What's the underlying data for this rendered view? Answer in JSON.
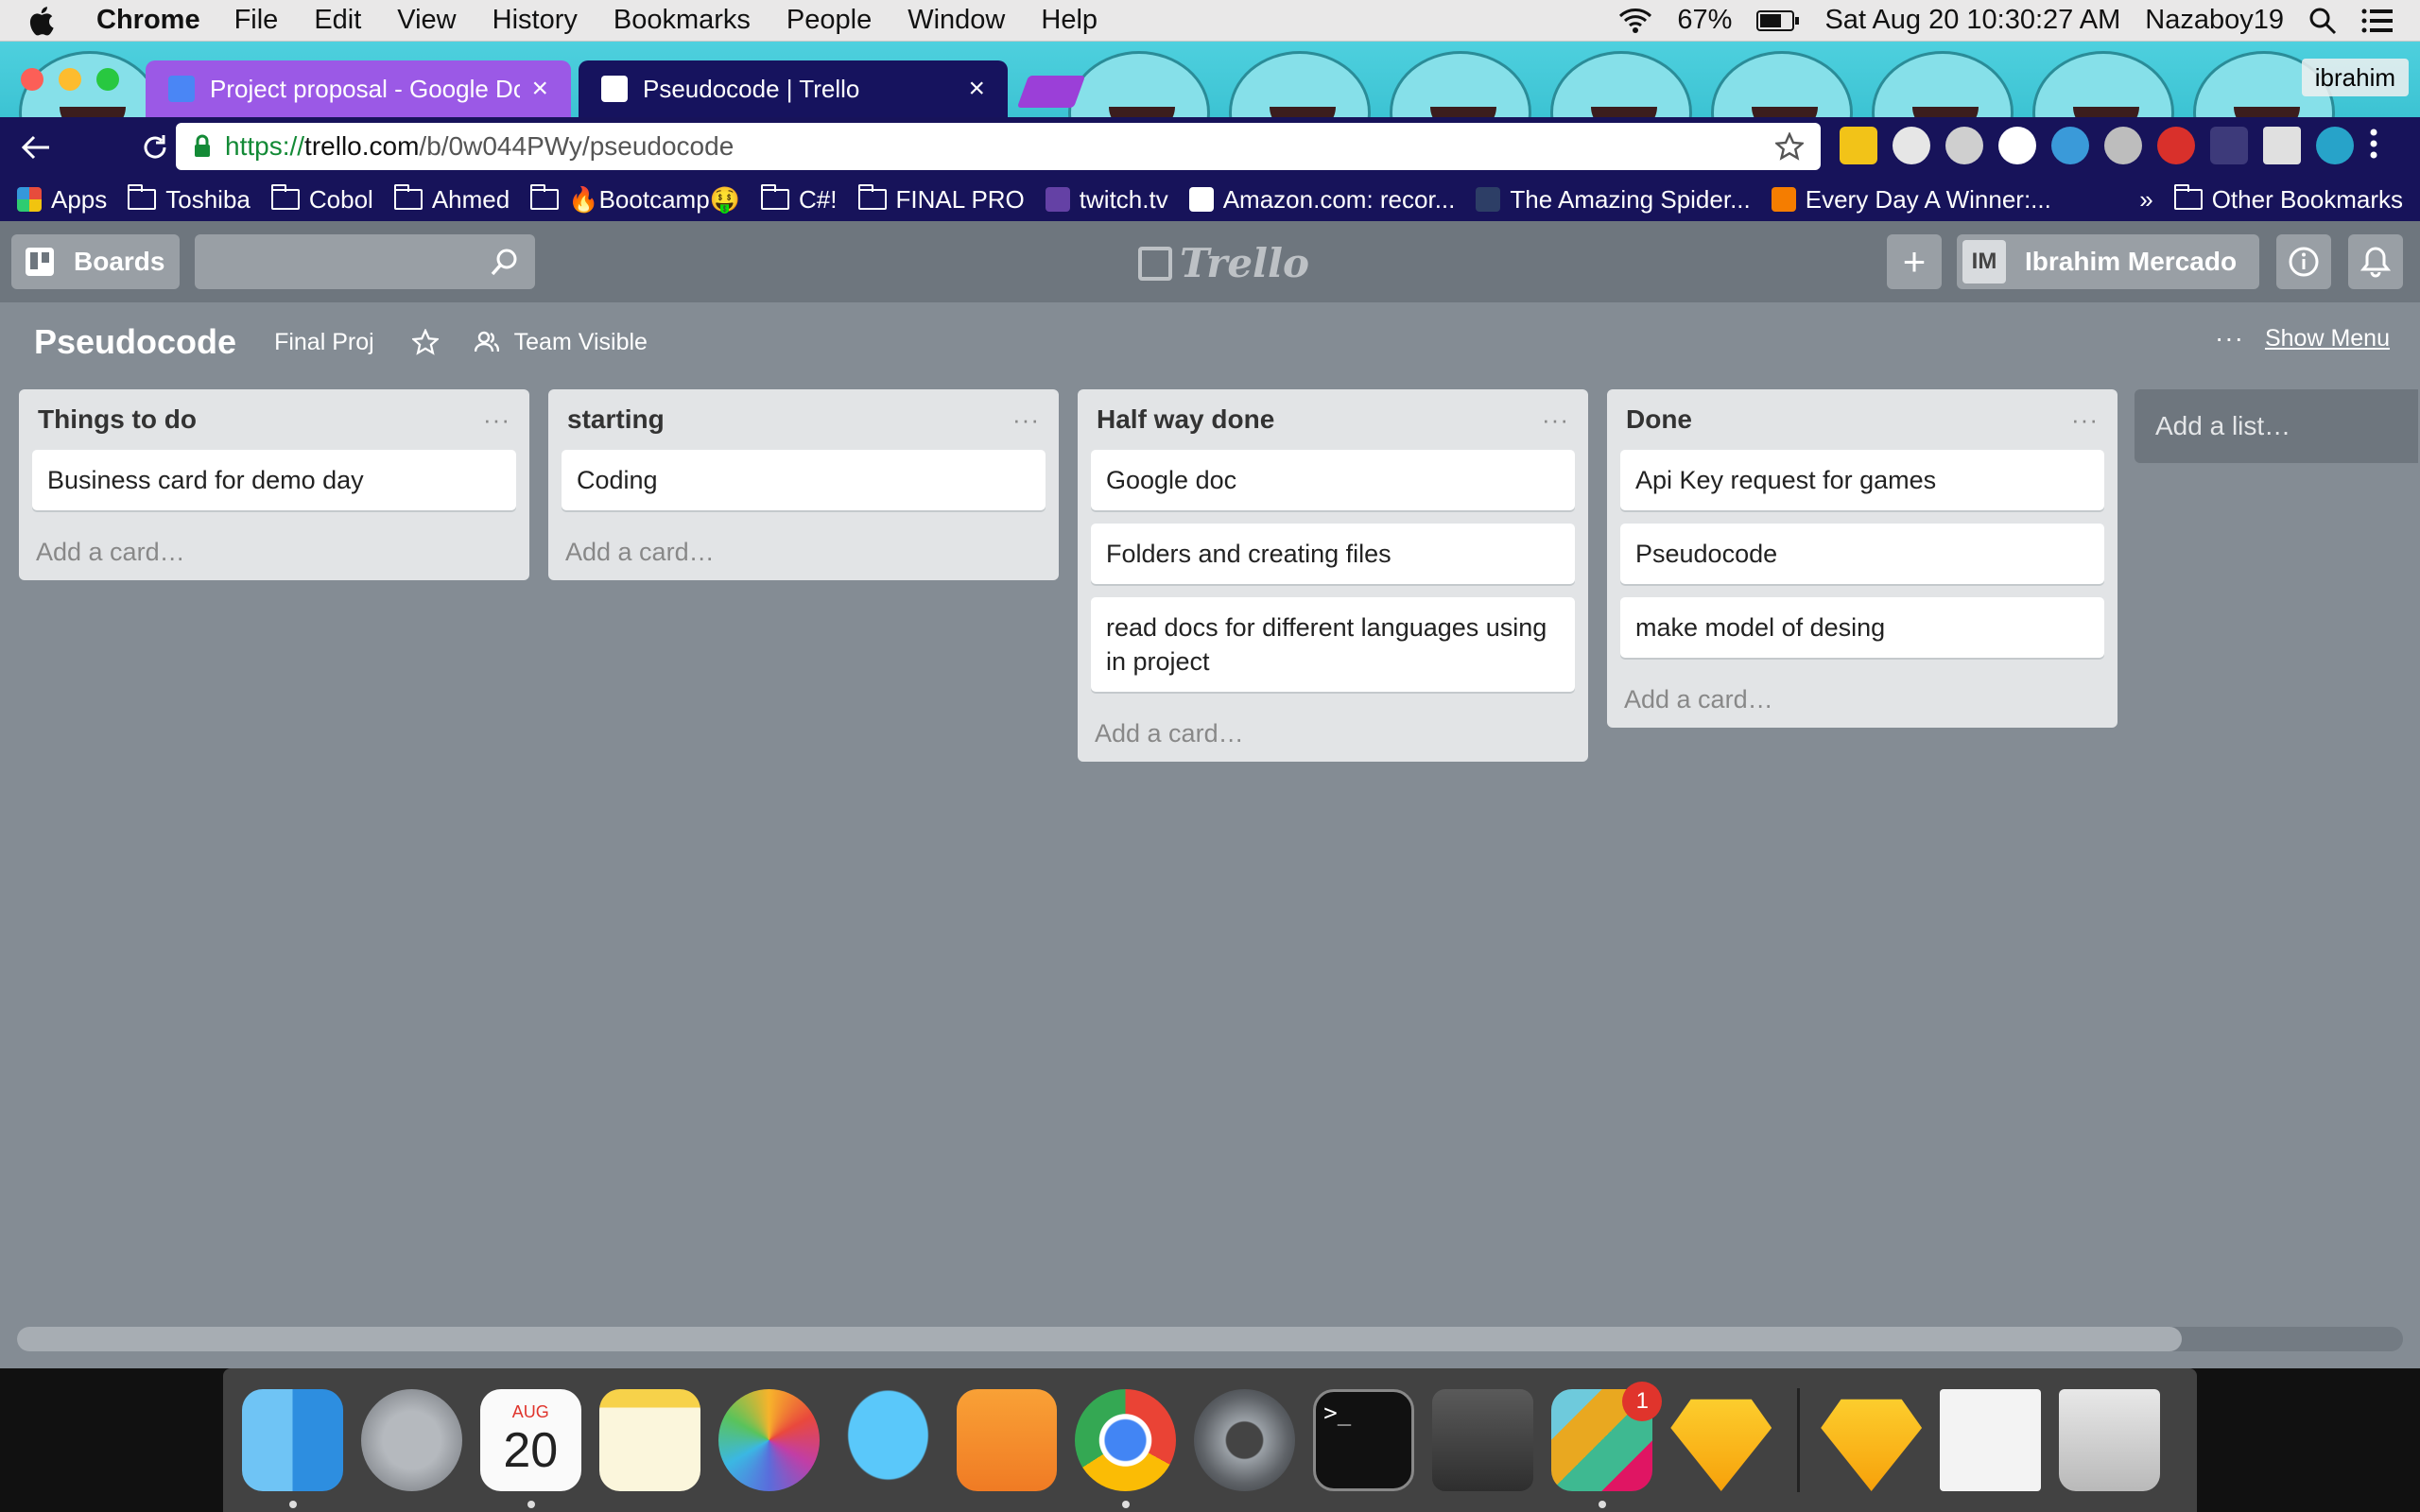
{
  "menubar": {
    "app_name": "Chrome",
    "items": [
      "File",
      "Edit",
      "View",
      "History",
      "Bookmarks",
      "People",
      "Window",
      "Help"
    ],
    "battery": "67%",
    "datetime": "Sat Aug 20  10:30:27 AM",
    "user": "Nazaboy19"
  },
  "browser": {
    "tabs": [
      {
        "title": "Project proposal - Google Doc",
        "active": false
      },
      {
        "title": "Pseudocode | Trello",
        "active": true
      }
    ],
    "profile_name": "ibrahim",
    "url": {
      "scheme": "https://",
      "host": "trello.com",
      "path": "/b/0w044PWy/pseudocode"
    },
    "bookmarks": [
      {
        "label": "Apps",
        "icon": "apps-icon"
      },
      {
        "label": "Toshiba",
        "icon": "folder-icon"
      },
      {
        "label": "Cobol",
        "icon": "folder-icon"
      },
      {
        "label": "Ahmed",
        "icon": "folder-icon"
      },
      {
        "label": "🔥Bootcamp🤑",
        "icon": "folder-icon"
      },
      {
        "label": "C#!",
        "icon": "folder-icon"
      },
      {
        "label": "FINAL PRO",
        "icon": "folder-icon"
      },
      {
        "label": "twitch.tv",
        "icon": "twitch-icon"
      },
      {
        "label": "Amazon.com: recor...",
        "icon": "amazon-icon"
      },
      {
        "label": "The Amazing Spider...",
        "icon": "mqm-icon"
      },
      {
        "label": "Every Day A Winner:...",
        "icon": "blogger-icon"
      }
    ],
    "bookmarks_overflow": "»",
    "other_bookmarks": "Other Bookmarks"
  },
  "trello": {
    "boards_label": "Boards",
    "logo_text": "Trello",
    "user_initials": "IM",
    "user_name": "Ibrahim Mercado",
    "board_title": "Pseudocode",
    "board_link": "Final Proj",
    "visibility": "Team Visible",
    "show_menu": "Show Menu",
    "lists": [
      {
        "title": "Things to do",
        "cards": [
          "Business card for demo day"
        ],
        "add_card": "Add a card…"
      },
      {
        "title": "starting",
        "cards": [
          "Coding"
        ],
        "add_card": "Add a card…"
      },
      {
        "title": "Half way done",
        "cards": [
          "Google doc",
          "Folders and creating files",
          "read docs for different languages using in project"
        ],
        "add_card": "Add a card…"
      },
      {
        "title": "Done",
        "cards": [
          "Api Key request for games",
          "Pseudocode",
          "make model of desing"
        ],
        "add_card": "Add a card…"
      }
    ],
    "add_list": "Add a list…"
  },
  "dock": {
    "apps": [
      {
        "name": "finder",
        "running": true
      },
      {
        "name": "launchpad",
        "running": false
      },
      {
        "name": "calendar",
        "running": true,
        "month": "AUG",
        "day": "20"
      },
      {
        "name": "notes",
        "running": false
      },
      {
        "name": "photos",
        "running": false
      },
      {
        "name": "messages",
        "running": false
      },
      {
        "name": "pages",
        "running": false
      },
      {
        "name": "chrome",
        "running": true
      },
      {
        "name": "system-preferences",
        "running": false
      },
      {
        "name": "terminal",
        "running": false,
        "prompt": ">_"
      },
      {
        "name": "sublime-text",
        "running": false
      },
      {
        "name": "slack",
        "running": true,
        "badge": "1"
      },
      {
        "name": "sketch",
        "running": true
      }
    ]
  }
}
